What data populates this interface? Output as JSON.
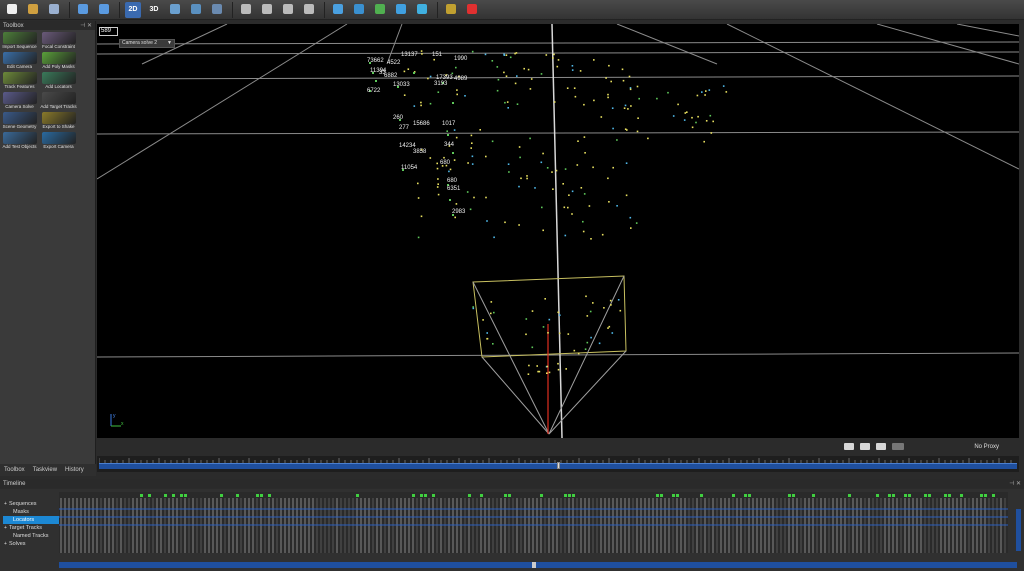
{
  "toolbar": {
    "buttons": [
      {
        "name": "new-icon"
      },
      {
        "name": "open-folder-icon"
      },
      {
        "name": "save-icon"
      },
      {
        "name": "undo-icon"
      },
      {
        "name": "redo-icon"
      },
      {
        "name": "view-2d-icon",
        "label": "2D"
      },
      {
        "name": "view-3d-icon",
        "label": "3D"
      },
      {
        "name": "camera-view-icon"
      },
      {
        "name": "graph-icon"
      },
      {
        "name": "grid-layout-icon"
      },
      {
        "name": "layout-single-icon"
      },
      {
        "name": "layout-split-icon"
      },
      {
        "name": "layout-rows-icon"
      },
      {
        "name": "layout-columns-icon"
      },
      {
        "name": "orbit-icon"
      },
      {
        "name": "globe-icon"
      },
      {
        "name": "world-icon"
      },
      {
        "name": "refresh-icon"
      },
      {
        "name": "fit-view-icon"
      },
      {
        "name": "plugin-icon"
      },
      {
        "name": "wrench-icon"
      }
    ]
  },
  "toolbox": {
    "title": "Toolbox",
    "tools": [
      {
        "label": "Import Sequence",
        "color": "#4d7f3a"
      },
      {
        "label": "Focal Constraint",
        "color": "#6a5a7a"
      },
      {
        "label": "Edit Camera",
        "color": "#3a6fa8"
      },
      {
        "label": "Add Poly Masks",
        "color": "#5aa03a"
      },
      {
        "label": "Track Features",
        "color": "#6d8a3a"
      },
      {
        "label": "Add Locators",
        "color": "#3a7a5a"
      },
      {
        "label": "Camera Solve",
        "color": "#5a5a8a"
      },
      {
        "label": "Add Target Tracks",
        "color": "#4a4a4a"
      },
      {
        "label": "Scene Geometry",
        "color": "#3a5a8a"
      },
      {
        "label": "Export to Shake",
        "color": "#8a7a2a"
      },
      {
        "label": "Add Test Objects",
        "color": "#3a6a9a"
      },
      {
        "label": "Export Camera",
        "color": "#2a6aa0"
      }
    ]
  },
  "left_tabs": [
    "Toolbox",
    "Taskview",
    "History"
  ],
  "viewport": {
    "frame": "589",
    "solve_select": "Camera solve 2",
    "labels": [
      {
        "text": "13137"
      },
      {
        "text": "151"
      },
      {
        "text": "1990"
      },
      {
        "text": "73662"
      },
      {
        "text": "4522"
      },
      {
        "text": "11394"
      },
      {
        "text": "33"
      },
      {
        "text": "6882"
      },
      {
        "text": "17393"
      },
      {
        "text": "4989"
      },
      {
        "text": "13033"
      },
      {
        "text": "6722"
      },
      {
        "text": "3193"
      },
      {
        "text": "260"
      },
      {
        "text": "15686"
      },
      {
        "text": "1017"
      },
      {
        "text": "277"
      },
      {
        "text": "14234"
      },
      {
        "text": "344"
      },
      {
        "text": "3858"
      },
      {
        "text": "680"
      },
      {
        "text": "11054"
      },
      {
        "text": "680"
      },
      {
        "text": "6351"
      },
      {
        "text": "2983"
      }
    ]
  },
  "status": {
    "proxy": "No Proxy"
  },
  "timeline": {
    "title": "Timeline",
    "tracks": [
      {
        "label": "Sequences",
        "expander": "+",
        "indent": false,
        "selected": false
      },
      {
        "label": "Masks",
        "expander": "",
        "indent": true,
        "selected": false
      },
      {
        "label": "Locators",
        "expander": "",
        "indent": true,
        "selected": true
      },
      {
        "label": "Target Tracks",
        "expander": "+",
        "indent": false,
        "selected": false
      },
      {
        "label": "Named Tracks",
        "expander": "",
        "indent": true,
        "selected": false
      },
      {
        "label": "Solves",
        "expander": "+",
        "indent": false,
        "selected": false
      }
    ]
  },
  "colors": {
    "accent_blue": "#1f4f9e",
    "selection": "#1c88d4",
    "point_yellow": "#e8e060",
    "point_green": "#5ec85a",
    "point_cyan": "#4fb8e8",
    "camera_frustum": "#d8d070"
  }
}
